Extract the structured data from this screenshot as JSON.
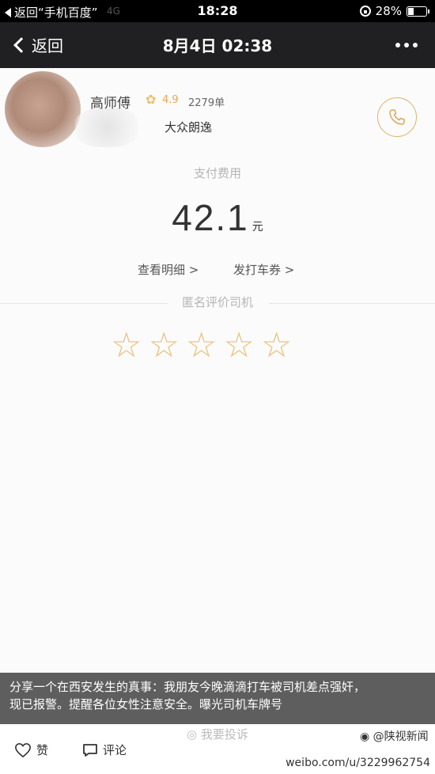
{
  "status_bar": {
    "back_app_label": "返回“手机百度”",
    "network_ghost": "4G",
    "time": "18:28",
    "battery": "28%"
  },
  "nav": {
    "back_label": "返回",
    "title": "8月4日 02:38",
    "more_icon": "more-dots-icon"
  },
  "driver": {
    "name": "高师傅",
    "rating": "4.9",
    "orders": "2279单",
    "car": "大众朗逸",
    "phone_icon": "phone-icon"
  },
  "payment": {
    "label": "支付费用",
    "amount": "42.1",
    "unit": "元",
    "detail_link": "查看明细 >",
    "coupon_link": "发打车券 >"
  },
  "rating_section": {
    "label": "匿名评价司机",
    "stars": 5,
    "filled": 0
  },
  "caption": {
    "line1": "分享一个在西安发生的真事：我朋友今晚滴滴打车被司机差点强奸，",
    "line2": "现已报警。提醒各位女性注意安全。曝光司机车牌号"
  },
  "complain_label": "我要投诉",
  "footer": {
    "like_label": "赞",
    "comment_label": "评论",
    "watermark_text": "@陕视新闻",
    "url": "weibo.com/u/3229962754"
  },
  "colors": {
    "accent_gold": "#e8c27a",
    "nav_bg": "#202022",
    "status_bg": "#000000"
  }
}
